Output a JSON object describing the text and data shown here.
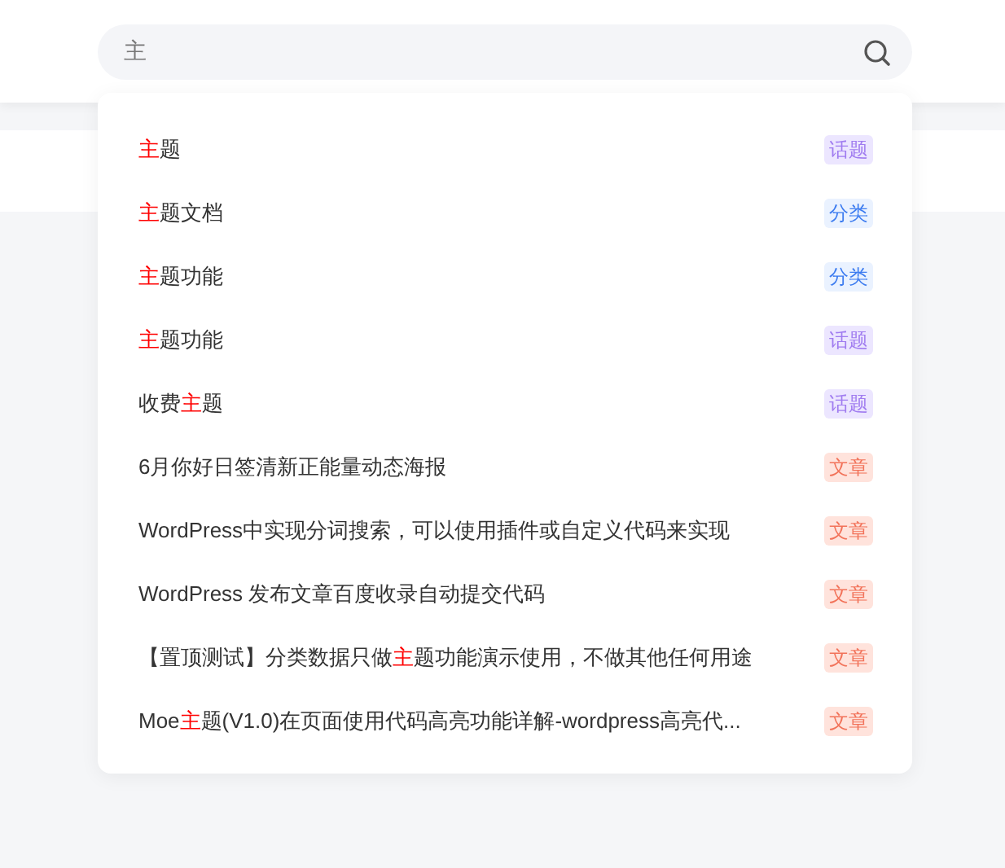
{
  "search": {
    "value": "主"
  },
  "results": [
    {
      "title": "**主**题",
      "tag": {
        "label": "话题",
        "kind": "topic"
      }
    },
    {
      "title": "**主**题文档",
      "tag": {
        "label": "分类",
        "kind": "category"
      }
    },
    {
      "title": "**主**题功能",
      "tag": {
        "label": "分类",
        "kind": "category"
      }
    },
    {
      "title": "**主**题功能",
      "tag": {
        "label": "话题",
        "kind": "topic"
      }
    },
    {
      "title": "收费**主**题",
      "tag": {
        "label": "话题",
        "kind": "topic"
      }
    },
    {
      "title": "6月你好日签清新正能量动态海报",
      "tag": {
        "label": "文章",
        "kind": "article"
      }
    },
    {
      "title": "WordPress中实现分词搜索，可以使用插件或自定义代码来实现",
      "tag": {
        "label": "文章",
        "kind": "article"
      }
    },
    {
      "title": "WordPress 发布文章百度收录自动提交代码",
      "tag": {
        "label": "文章",
        "kind": "article"
      }
    },
    {
      "title": "【置顶测试】分类数据只做**主**题功能演示使用，不做其他任何用途",
      "tag": {
        "label": "文章",
        "kind": "article"
      }
    },
    {
      "title": "Moe**主**题(V1.0)在页面使用代码高亮功能详解-wordpress高亮代...",
      "tag": {
        "label": "文章",
        "kind": "article"
      }
    }
  ]
}
